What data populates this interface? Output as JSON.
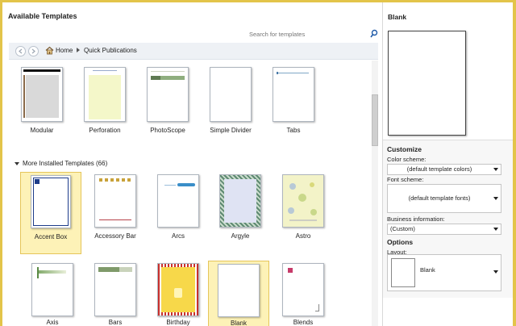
{
  "main": {
    "heading": "Available Templates",
    "search": {
      "placeholder": "Search for templates"
    },
    "breadcrumb": {
      "home": "Home",
      "current": "Quick Publications"
    },
    "top_templates": [
      {
        "label": "Modular"
      },
      {
        "label": "Perforation"
      },
      {
        "label": "PhotoScope"
      },
      {
        "label": "Simple Divider"
      },
      {
        "label": "Tabs"
      }
    ],
    "section_title": "More Installed Templates (66)",
    "installed_row1": [
      {
        "label": "Accent Box"
      },
      {
        "label": "Accessory Bar"
      },
      {
        "label": "Arcs"
      },
      {
        "label": "Argyle"
      },
      {
        "label": "Astro"
      }
    ],
    "installed_row2": [
      {
        "label": "Axis"
      },
      {
        "label": "Bars"
      },
      {
        "label": "Birthday"
      },
      {
        "label": "Blank"
      },
      {
        "label": "Blends"
      }
    ]
  },
  "side": {
    "title": "Blank",
    "customize_heading": "Customize",
    "color_scheme_label": "Color scheme:",
    "color_scheme_value": "(default template colors)",
    "font_scheme_label": "Font scheme:",
    "font_scheme_value": "(default template fonts)",
    "business_info_label": "Business information:",
    "business_info_value": "(Custom)",
    "options_heading": "Options",
    "layout_label": "Layout:",
    "layout_value": "Blank"
  },
  "colors": {
    "selection_fill": "#fdf2b7",
    "selection_border": "#e5c55a",
    "window_border": "#e3c44a"
  }
}
